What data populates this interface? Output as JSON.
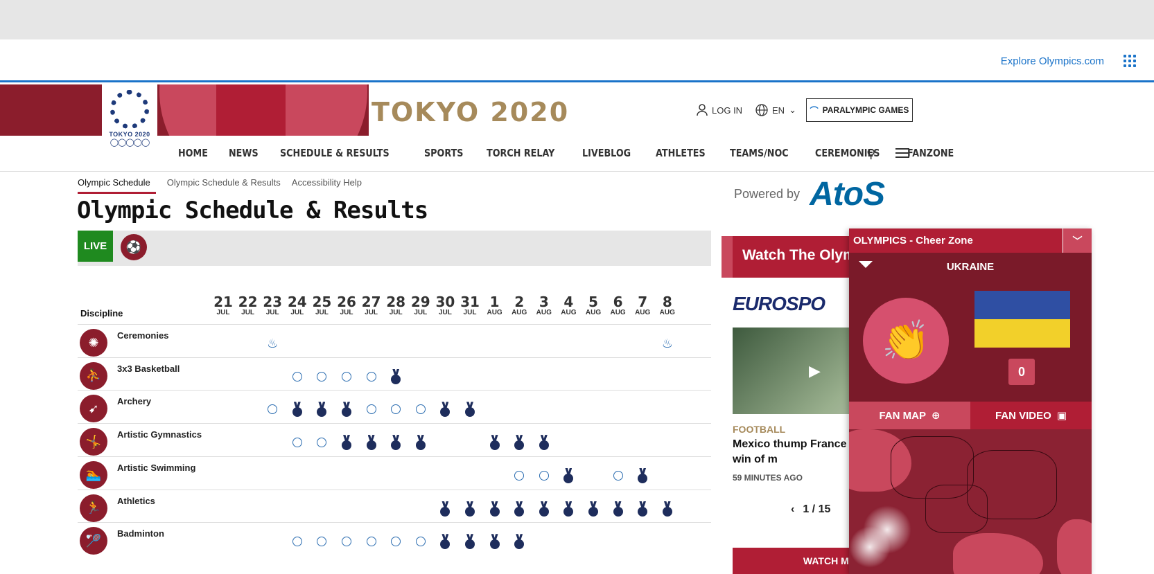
{
  "explore": {
    "link": "Explore Olympics.com"
  },
  "header": {
    "logo_text": "TOKYO 2020",
    "title": "TOKYO 2020",
    "login": "LOG IN",
    "lang": "EN",
    "paralympic": "PARALYMPIC GAMES"
  },
  "nav": [
    "HOME",
    "NEWS",
    "SCHEDULE & RESULTS",
    "SPORTS",
    "TORCH RELAY",
    "LIVEBLOG",
    "ATHLETES",
    "TEAMS/NOC",
    "CEREMONIES",
    "FANZONE"
  ],
  "subtabs": [
    "Olympic Schedule",
    "Olympic Schedule & Results",
    "Accessibility Help"
  ],
  "page_title": "Olympic Schedule & Results",
  "live_label": "LIVE",
  "schedule": {
    "discipline_label": "Discipline",
    "dates": [
      {
        "d": "21",
        "m": "JUL"
      },
      {
        "d": "22",
        "m": "JUL"
      },
      {
        "d": "23",
        "m": "JUL"
      },
      {
        "d": "24",
        "m": "JUL"
      },
      {
        "d": "25",
        "m": "JUL"
      },
      {
        "d": "26",
        "m": "JUL"
      },
      {
        "d": "27",
        "m": "JUL"
      },
      {
        "d": "28",
        "m": "JUL"
      },
      {
        "d": "29",
        "m": "JUL"
      },
      {
        "d": "30",
        "m": "JUL"
      },
      {
        "d": "31",
        "m": "JUL"
      },
      {
        "d": "1",
        "m": "AUG"
      },
      {
        "d": "2",
        "m": "AUG"
      },
      {
        "d": "3",
        "m": "AUG"
      },
      {
        "d": "4",
        "m": "AUG"
      },
      {
        "d": "5",
        "m": "AUG"
      },
      {
        "d": "6",
        "m": "AUG"
      },
      {
        "d": "7",
        "m": "AUG"
      },
      {
        "d": "8",
        "m": "AUG"
      }
    ],
    "rows": [
      {
        "name": "Ceremonies",
        "icon": "ceremonies-icon",
        "glyph": "✺",
        "marks": {
          "2": "flame",
          "18": "flame"
        }
      },
      {
        "name": "3x3 Basketball",
        "icon": "basketball-icon",
        "glyph": "⛹",
        "marks": {
          "3": "ring",
          "4": "ring",
          "5": "ring",
          "6": "ring",
          "7": "medal"
        }
      },
      {
        "name": "Archery",
        "icon": "archery-icon",
        "glyph": "➹",
        "marks": {
          "2": "ring",
          "3": "medal",
          "4": "medal",
          "5": "medal",
          "6": "ring",
          "7": "ring",
          "8": "ring",
          "9": "medal",
          "10": "medal"
        }
      },
      {
        "name": "Artistic Gymnastics",
        "icon": "gymnastics-icon",
        "glyph": "🤸",
        "marks": {
          "3": "ring",
          "4": "ring",
          "5": "medal",
          "6": "medal",
          "7": "medal",
          "8": "medal",
          "11": "medal",
          "12": "medal",
          "13": "medal"
        }
      },
      {
        "name": "Artistic Swimming",
        "icon": "swimming-icon",
        "glyph": "🏊",
        "marks": {
          "12": "ring",
          "13": "ring",
          "14": "medal",
          "16": "ring",
          "17": "medal"
        }
      },
      {
        "name": "Athletics",
        "icon": "athletics-icon",
        "glyph": "🏃",
        "marks": {
          "9": "medal",
          "10": "medal",
          "11": "medal",
          "12": "medal",
          "13": "medal",
          "14": "medal",
          "15": "medal",
          "16": "medal",
          "17": "medal",
          "18": "medal"
        }
      },
      {
        "name": "Badminton",
        "icon": "badminton-icon",
        "glyph": "🏸",
        "marks": {
          "3": "ring",
          "4": "ring",
          "5": "ring",
          "6": "ring",
          "7": "ring",
          "8": "ring",
          "9": "medal",
          "10": "medal",
          "11": "medal",
          "12": "medal"
        }
      }
    ]
  },
  "powered": {
    "label": "Powered by",
    "brand": "AtoS"
  },
  "watch": {
    "title": "Watch The Olym",
    "broadcaster": "EUROSPO",
    "tag": "FOOTBALL",
    "headline": "Mexico thump France i to claim first win of m",
    "time": "59 MINUTES AGO",
    "pager": "1 / 15",
    "more": "WATCH MORE"
  },
  "cheer": {
    "title": "OLYMPICS - Cheer Zone",
    "country": "UKRAINE",
    "count": "0",
    "fan_map": "FAN MAP",
    "fan_video": "FAN VIDEO"
  }
}
